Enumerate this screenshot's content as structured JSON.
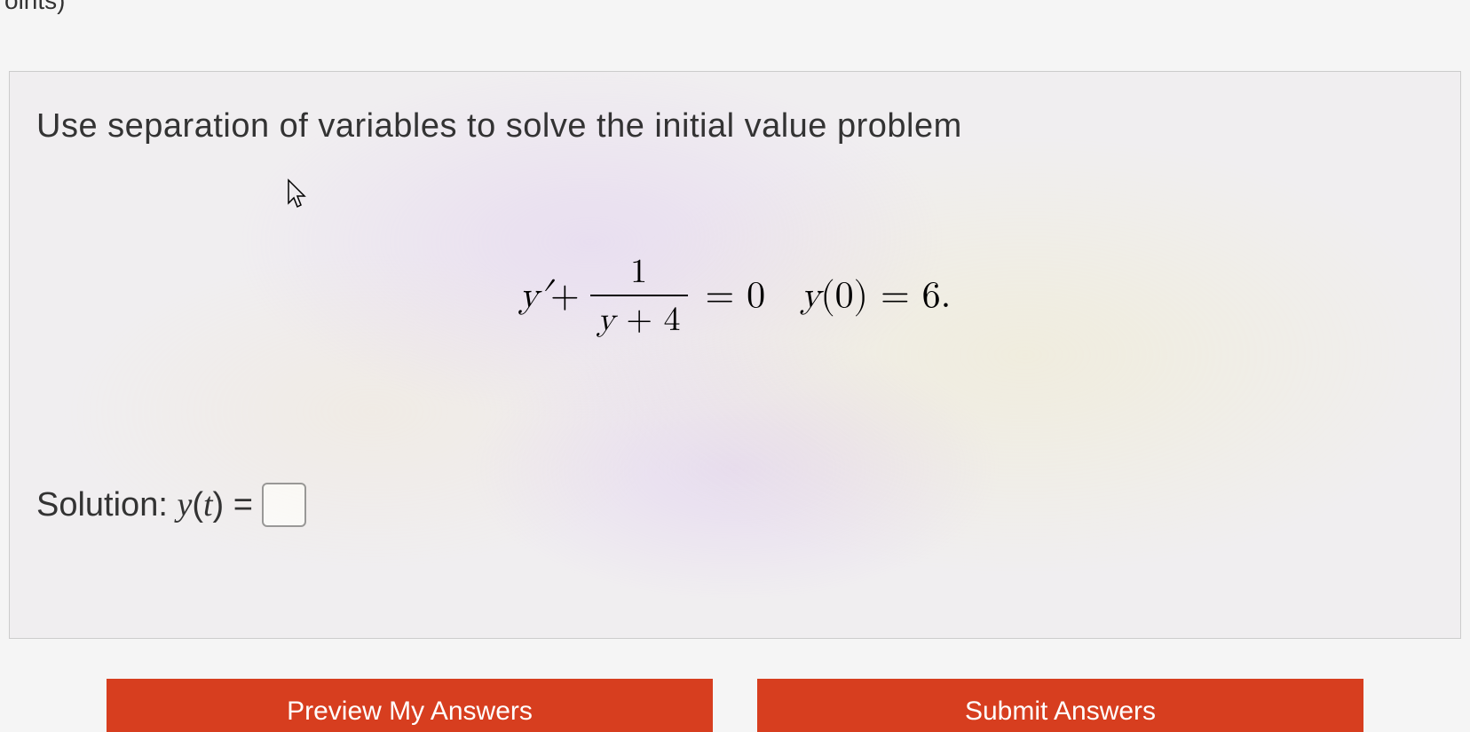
{
  "partial_header": "oints)",
  "question": {
    "prompt": "Use separation of variables to solve the initial value problem",
    "equation": {
      "lhs_yprime": "y′",
      "plus": " + ",
      "numerator": "1",
      "denominator_y": "y",
      "denominator_plus4": " + 4",
      "equals_zero": " = 0",
      "spacer": "   ",
      "ic_y": "y",
      "ic_paren": "(0) = 6."
    },
    "solution_label": "Solution: ",
    "solution_y": "y",
    "solution_paren": "(",
    "solution_t": "t",
    "solution_paren_close": ") = "
  },
  "buttons": {
    "previous": "Preview My Answers",
    "submit": "Submit Answers"
  }
}
